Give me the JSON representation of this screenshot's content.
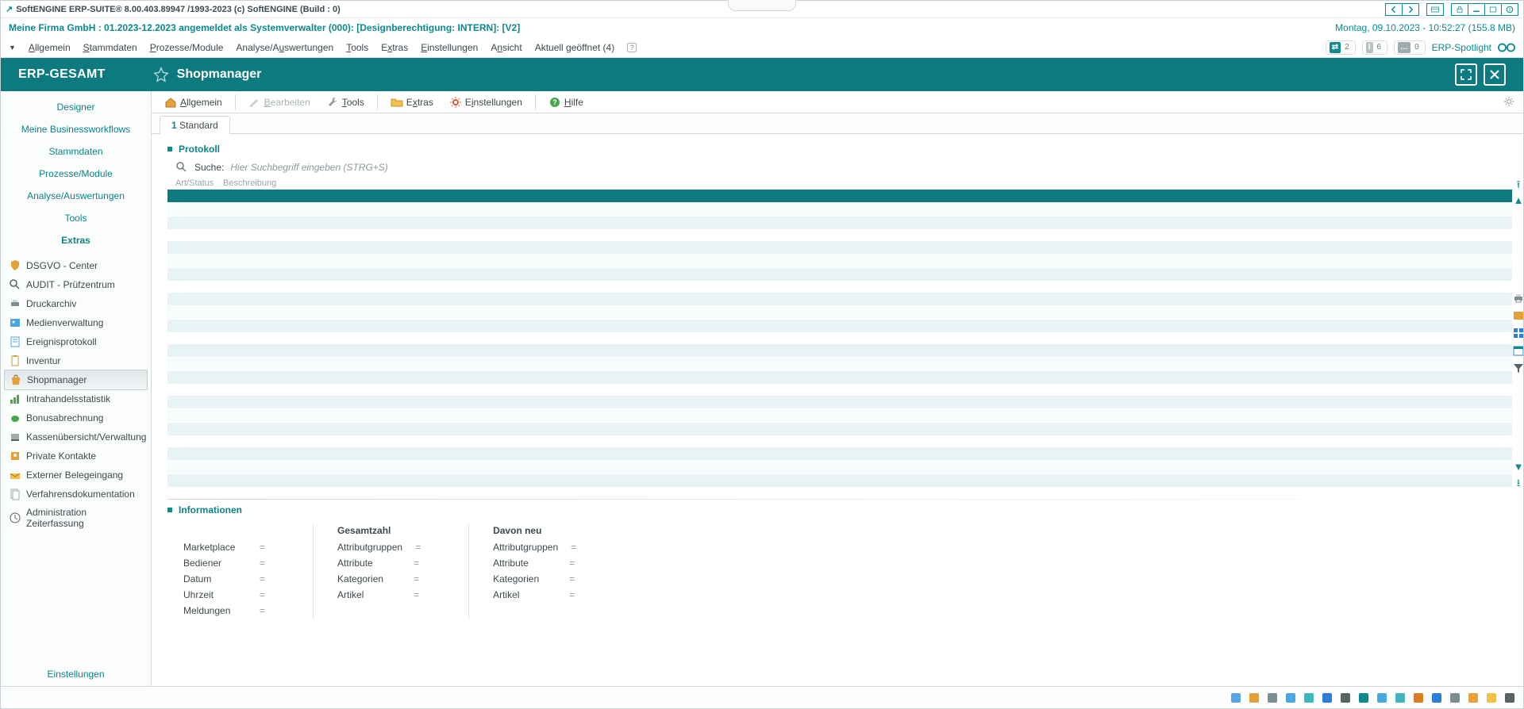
{
  "chrome": {
    "title": "SoftENGINE ERP-SUITE® 8.00.403.89947 /1993-2023 (c) SoftENGINE (Build : 0)"
  },
  "identity": {
    "left": "Meine Firma GmbH : 01.2023-12.2023 angemeldet als Systemverwalter (000): [Designberechtigung: INTERN]: [V2]",
    "right": "Montag, 09.10.2023 - 10:52:27 (155.8 MB)"
  },
  "menu": {
    "items": [
      "Allgemein",
      "Stammdaten",
      "Prozesse/Module",
      "Analyse/Auswertungen",
      "Tools",
      "Extras",
      "Einstellungen",
      "Ansicht"
    ],
    "open_label": "Aktuell geöffnet (4)",
    "spotlight": "ERP-Spotlight",
    "pills": [
      {
        "icon": "⇄",
        "count": "2"
      },
      {
        "icon": "I",
        "count": "6"
      },
      {
        "icon": "…",
        "count": "0"
      }
    ]
  },
  "header": {
    "app": "ERP-GESAMT",
    "title": "Shopmanager"
  },
  "sidebar": {
    "nav": [
      "Designer",
      "Meine Businessworkflows",
      "Stammdaten",
      "Prozesse/Module",
      "Analyse/Auswertungen",
      "Tools",
      "Extras"
    ],
    "nav_active_index": 6,
    "items": [
      {
        "icon": "shield",
        "label": "DSGVO - Center"
      },
      {
        "icon": "magnify",
        "label": "AUDIT - Prüfzentrum"
      },
      {
        "icon": "printer",
        "label": "Druckarchiv"
      },
      {
        "icon": "media",
        "label": "Medienverwaltung"
      },
      {
        "icon": "log",
        "label": "Ereignisprotokoll"
      },
      {
        "icon": "clipboard",
        "label": "Inventur"
      },
      {
        "icon": "bag",
        "label": "Shopmanager"
      },
      {
        "icon": "stats",
        "label": "Intrahandelsstatistik"
      },
      {
        "icon": "piggy",
        "label": "Bonusabrechnung"
      },
      {
        "icon": "register",
        "label": "Kassenübersicht/Verwaltung"
      },
      {
        "icon": "contact",
        "label": "Private Kontakte"
      },
      {
        "icon": "inbox",
        "label": "Externer Belegeingang"
      },
      {
        "icon": "docs",
        "label": "Verfahrensdokumentation"
      },
      {
        "icon": "clock",
        "label": "Administration Zeiterfassung"
      }
    ],
    "selected_index": 6,
    "footer": "Einstellungen"
  },
  "toolbar": {
    "allgemein": "Allgemein",
    "bearbeiten": "Bearbeiten",
    "tools": "Tools",
    "extras": "Extras",
    "einstellungen": "Einstellungen",
    "hilfe": "Hilfe"
  },
  "tabs": {
    "standard_prefix": "1",
    "standard_label": "Standard"
  },
  "protokoll": {
    "title": "Protokoll",
    "search_label": "Suche:",
    "search_placeholder": "Hier Suchbegriff eingeben (STRG+S)",
    "cols": {
      "c1": "Art/Status",
      "c2": "Beschreibung"
    }
  },
  "informationen": {
    "title": "Informationen",
    "col1_header": "",
    "col1": [
      {
        "label": "Marketplace",
        "value": "="
      },
      {
        "label": "Bediener",
        "value": "="
      },
      {
        "label": "Datum",
        "value": "="
      },
      {
        "label": "Uhrzeit",
        "value": "="
      },
      {
        "label": "Meldungen",
        "value": "="
      }
    ],
    "col2_header": "Gesamtzahl",
    "col2": [
      {
        "label": "Attributgruppen",
        "value": "="
      },
      {
        "label": "Attribute",
        "value": "="
      },
      {
        "label": "Kategorien",
        "value": "="
      },
      {
        "label": "Artikel",
        "value": "="
      }
    ],
    "col3_header": "Davon neu",
    "col3": [
      {
        "label": "Attributgruppen",
        "value": "="
      },
      {
        "label": "Attribute",
        "value": "="
      },
      {
        "label": "Kategorien",
        "value": "="
      },
      {
        "label": "Artikel",
        "value": "="
      }
    ]
  }
}
